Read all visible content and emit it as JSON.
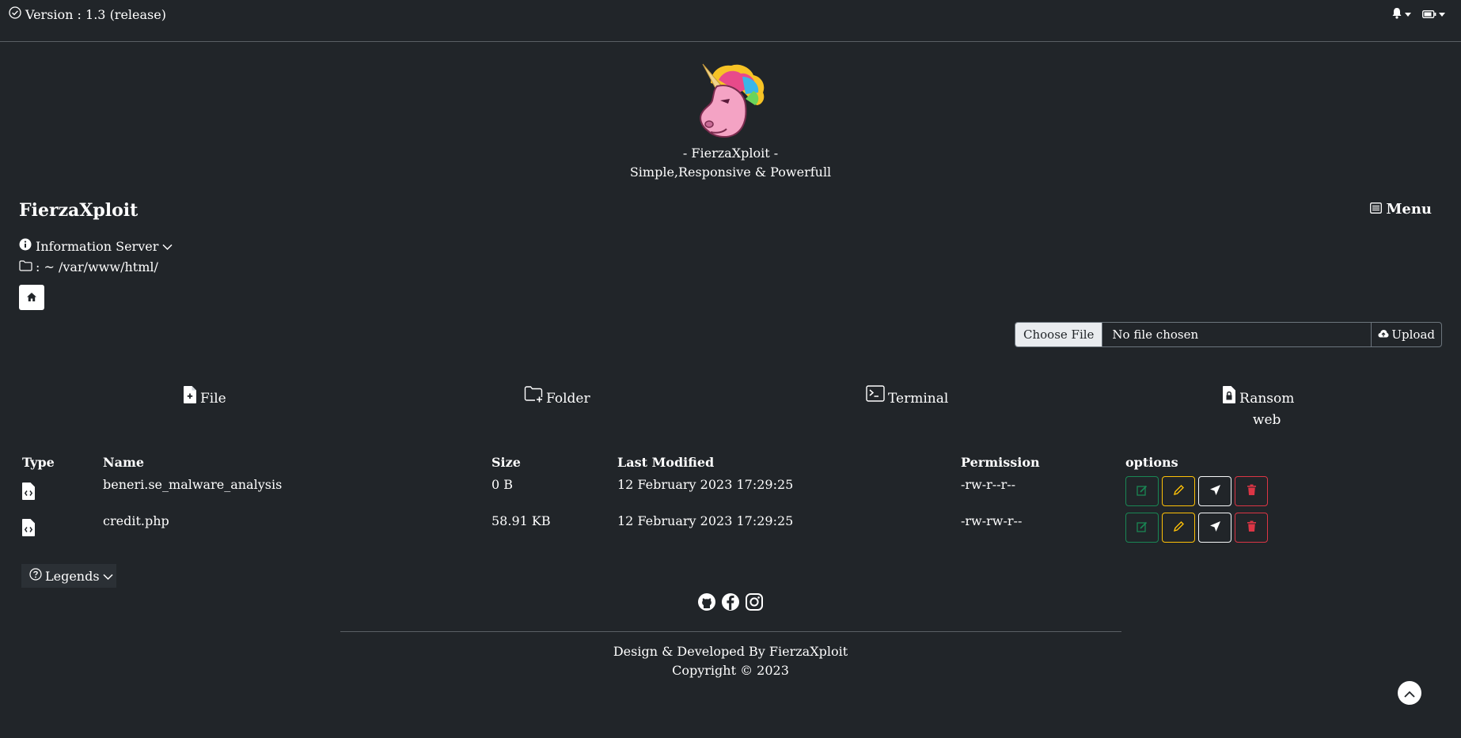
{
  "topbar": {
    "version_text": "Version : 1.3 (release)",
    "icons": [
      "check-circle-icon",
      "bell-icon",
      "battery-icon"
    ]
  },
  "header": {
    "logo": "unicorn-logo",
    "title_line": "- FierzaXploit -",
    "subtitle_line": "Simple,Responsive & Powerfull"
  },
  "nav": {
    "brand": "FierzaXploit",
    "menu_label": "Menu"
  },
  "info": {
    "server_label": "Information Server",
    "path_label": ": ~ /var/www/html/"
  },
  "upload": {
    "choose_label": "Choose File",
    "status": "No file chosen",
    "upload_label": "Upload"
  },
  "actions": {
    "file": "File",
    "folder": "Folder",
    "terminal": "Terminal",
    "ransom_line1": "Ransom",
    "ransom_line2": "web"
  },
  "table": {
    "headers": {
      "type": "Type",
      "name": "Name",
      "size": "Size",
      "modified": "Last Modified",
      "permission": "Permission",
      "options": "options"
    },
    "rows": [
      {
        "name": "beneri.se_malware_analysis",
        "size": "0 B",
        "modified": "12 February 2023 17:29:25",
        "permission": "-rw-r--r--"
      },
      {
        "name": "credit.php",
        "size": "58.91 KB",
        "modified": "12 February 2023 17:29:25",
        "permission": "-rw-rw-r--"
      }
    ]
  },
  "legends_label": "Legends",
  "footer": {
    "line1": "Design & Developed By FierzaXploit",
    "line2": "Copyright © 2023"
  },
  "colors": {
    "background": "#212529",
    "edit": "#198754",
    "rename": "#ffc107",
    "delete": "#dc3545"
  }
}
